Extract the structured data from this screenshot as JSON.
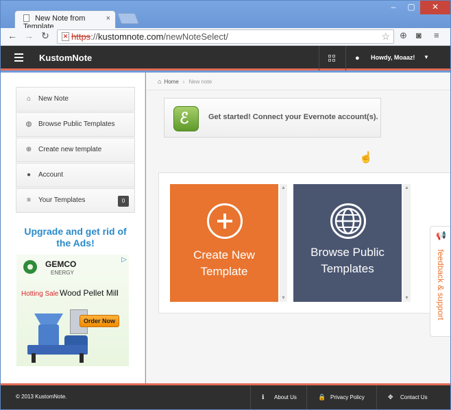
{
  "browser": {
    "tab_title": "New Note from Template",
    "tab_close": "×",
    "url_scheme": "https",
    "url_sep": "://",
    "url_host": "kustomnote.com",
    "url_path": "/newNoteSelect/"
  },
  "header": {
    "brand": "KustomNote",
    "user_greeting": "Howdy, Moaaz!"
  },
  "sidebar": {
    "items": [
      {
        "label": "New Note",
        "icon": "home-icon"
      },
      {
        "label": "Browse Public Templates",
        "icon": "globe-icon"
      },
      {
        "label": "Create new template",
        "icon": "plus-circle-icon"
      },
      {
        "label": "Account",
        "icon": "user-icon"
      },
      {
        "label": "Your Templates",
        "icon": "list-icon",
        "count": "0"
      }
    ],
    "upgrade_text": "Upgrade and get rid of the Ads!"
  },
  "ad": {
    "brand": "GEMCO",
    "sub": "ENERGY",
    "hot": "Hotting Sale",
    "product": "Wood Pellet Mill",
    "cta": "Order Now"
  },
  "breadcrumb": {
    "home": "Home",
    "current": "New note"
  },
  "evernote": {
    "text": "Get started! Connect your Evernote account(s)."
  },
  "tiles": {
    "create": "Create New Template",
    "browse": "Browse Public Templates"
  },
  "feedback": {
    "label": "feedback & support"
  },
  "footer": {
    "copyright": "© 2013 KustomNote.",
    "about": "About Us",
    "privacy": "Privacy Policy",
    "contact": "Contact Us"
  },
  "colors": {
    "accent": "#e36b57",
    "create_tile": "#e8742f",
    "browse_tile": "#4a5570",
    "upgrade_text": "#2a8ac9"
  }
}
